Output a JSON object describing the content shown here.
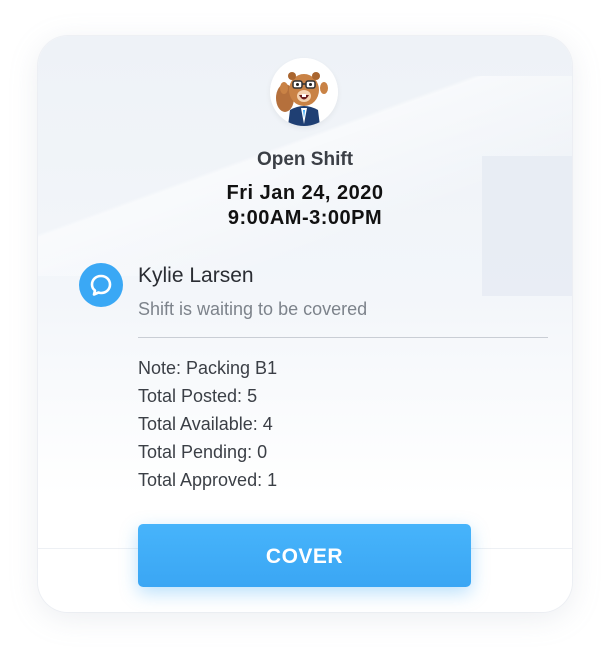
{
  "shift": {
    "title": "Open Shift",
    "date": "Fri Jan 24, 2020",
    "time": "9:00AM-3:00PM"
  },
  "message": {
    "icon": "chat-bubble-icon",
    "user_name": "Kylie Larsen",
    "status": "Shift is waiting to be covered"
  },
  "details": [
    "Note: Packing B1",
    "Total Posted: 5",
    "Total Available: 4",
    "Total Pending: 0",
    "Total Approved: 1"
  ],
  "actions": {
    "cover_label": "COVER"
  },
  "colors": {
    "accent": "#3aa8f5",
    "title_text": "#3b3f46",
    "muted_text": "#7d838b"
  },
  "avatar": {
    "icon": "beaver-mascot-icon"
  }
}
